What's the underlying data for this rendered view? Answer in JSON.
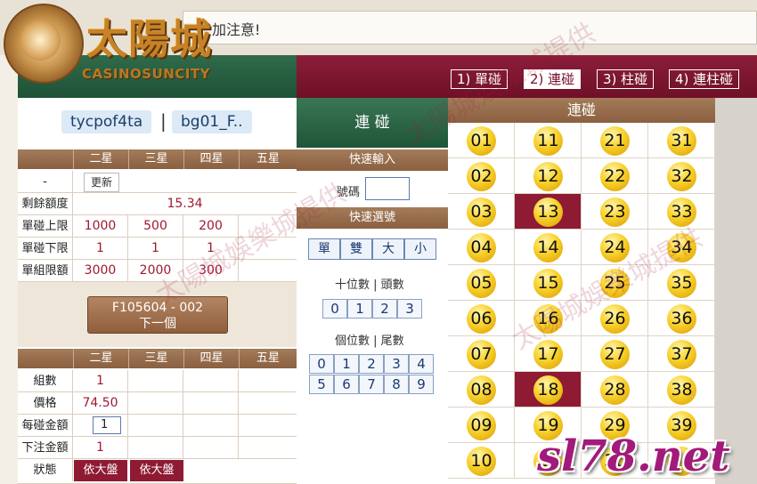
{
  "notice": {
    "text": "加注意!"
  },
  "logo": {
    "cn": "太陽城",
    "en": "CASINOSUNCITY",
    "overlay_num": "3"
  },
  "top_tabs": [
    {
      "label": "1) 單碰",
      "active": false
    },
    {
      "label": "2) 連碰",
      "active": true
    },
    {
      "label": "3) 柱碰",
      "active": false
    },
    {
      "label": "4) 連柱碰",
      "active": false
    }
  ],
  "user": {
    "account": "tycpof4ta",
    "separator": "|",
    "game": "bg01_F.."
  },
  "star_headers": [
    "二星",
    "三星",
    "四星",
    "五星"
  ],
  "limits": {
    "refresh_label": "更新",
    "dash": "-",
    "rows": [
      {
        "label": "剩餘額度",
        "merged": "15.34"
      },
      {
        "label": "單碰上限",
        "values": [
          "1000",
          "500",
          "200",
          ""
        ]
      },
      {
        "label": "單碰下限",
        "values": [
          "1",
          "1",
          "1",
          ""
        ]
      },
      {
        "label": "單組限額",
        "values": [
          "3000",
          "2000",
          "300",
          ""
        ]
      }
    ]
  },
  "next_button": {
    "line1": "F105604 - 002",
    "line2": "下一個"
  },
  "bet": {
    "rows": [
      {
        "label": "組數",
        "value": "1"
      },
      {
        "label": "價格",
        "value": "74.50"
      },
      {
        "label": "每碰金額",
        "value": "1"
      },
      {
        "label": "下注金額",
        "value": "1"
      },
      {
        "label": "狀態"
      }
    ],
    "status_buttons": [
      "依大盤",
      "依大盤"
    ]
  },
  "controls": {
    "title": "連 碰",
    "quick_input": "快速輸入",
    "number_label": "號碼",
    "number_value": "",
    "quick_select": "快速選號",
    "parity": [
      "單",
      "雙",
      "大",
      "小"
    ],
    "tens_label": "十位數 | 頭數",
    "tens": [
      "0",
      "1",
      "2",
      "3"
    ],
    "units_label": "個位數 | 尾數",
    "units": [
      "0",
      "1",
      "2",
      "3",
      "4",
      "5",
      "6",
      "7",
      "8",
      "9"
    ]
  },
  "numbers": {
    "title": "連碰",
    "balls": [
      "01",
      "11",
      "21",
      "31",
      "02",
      "12",
      "22",
      "32",
      "03",
      "13",
      "23",
      "33",
      "04",
      "14",
      "24",
      "34",
      "05",
      "15",
      "25",
      "35",
      "06",
      "16",
      "26",
      "36",
      "07",
      "17",
      "27",
      "37",
      "08",
      "18",
      "28",
      "38",
      "09",
      "19",
      "29",
      "39",
      "10",
      "20",
      "30",
      "40"
    ],
    "selected": [
      "13",
      "18"
    ]
  },
  "watermark": {
    "text": "太陽城娛樂城提供"
  },
  "site_mark": "sl78.net",
  "colors": {
    "accent_crimson": "#8e1a33",
    "green": "#2f6b4a",
    "brown": "#8a6040",
    "ball_yellow": "#f8d12a"
  }
}
